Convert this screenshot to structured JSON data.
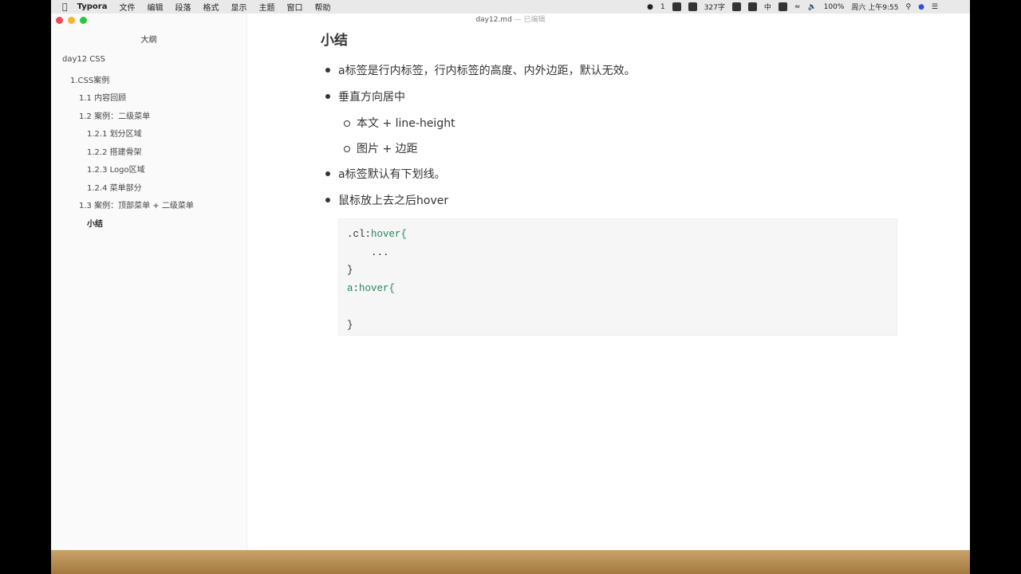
{
  "menubar": {
    "app": "Typora",
    "items": [
      "文件",
      "编辑",
      "段落",
      "格式",
      "显示",
      "主题",
      "窗口",
      "帮助"
    ],
    "status": {
      "wechat_count": "1",
      "word_count": "327字",
      "input_method": "中",
      "battery": "100%",
      "datetime": "周六 上午9:55"
    }
  },
  "window": {
    "filename": "day12.md",
    "edited": "— 已编辑"
  },
  "sidebar": {
    "title": "大纲",
    "items": [
      "day12 CSS",
      "1.CSS案例",
      "1.1 内容回顾",
      "1.2 案例：二级菜单",
      "1.2.1 划分区域",
      "1.2.2 搭建骨架",
      "1.2.3 Logo区域",
      "1.2.4 菜单部分",
      "1.3 案例：顶部菜单 + 二级菜单",
      "小结"
    ]
  },
  "content": {
    "heading": "小结",
    "bullets": [
      "a标签是行内标签，行内标签的高度、内外边距，默认无效。",
      "垂直方向居中",
      "本文 + line-height",
      "图片 + 边距",
      "a标签默认有下划线。",
      "鼠标放上去之后hover"
    ],
    "code": {
      "l1a": ".cl:",
      "l1b": "hover{",
      "l2": "    ...",
      "l3": "}",
      "l4a": "a",
      ":": ":",
      "l4b": "hover{",
      "l6": "}"
    }
  }
}
